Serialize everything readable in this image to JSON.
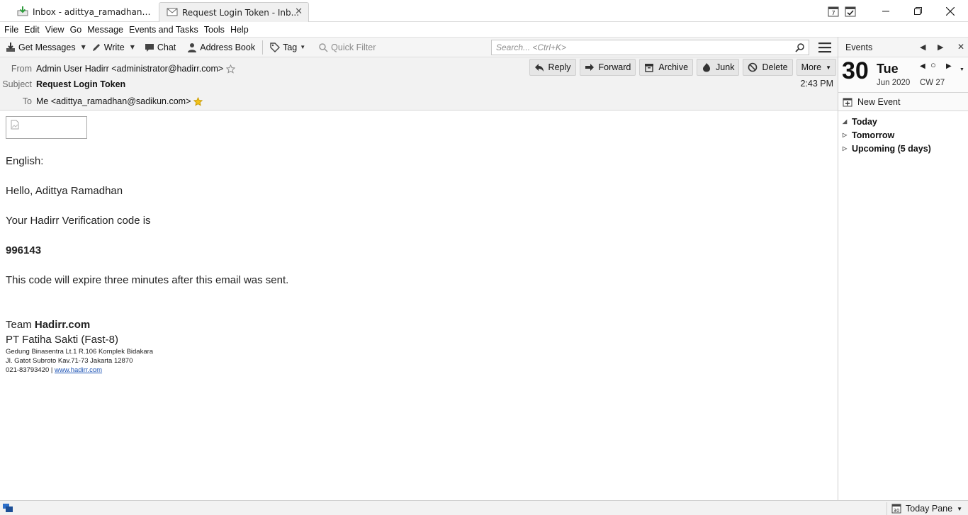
{
  "tabs": [
    {
      "label": "Inbox - adittya_ramadhan@sa...",
      "icon": "inbox-download-icon"
    },
    {
      "label": "Request Login Token - Inb...",
      "icon": "envelope-icon",
      "active": true
    }
  ],
  "menu": [
    "File",
    "Edit",
    "View",
    "Go",
    "Message",
    "Events and Tasks",
    "Tools",
    "Help"
  ],
  "toolbar": {
    "get_messages": "Get Messages",
    "write": "Write",
    "chat": "Chat",
    "address_book": "Address Book",
    "tag": "Tag",
    "quick_filter": "Quick Filter",
    "search_placeholder": "Search... <Ctrl+K>"
  },
  "header": {
    "from_label": "From",
    "from_value": "Admin User Hadirr <administrator@hadirr.com>",
    "subject_label": "Subject",
    "subject_value": "Request Login Token",
    "to_label": "To",
    "to_value": "Me <adittya_ramadhan@sadikun.com>",
    "time": "2:43 PM",
    "buttons": {
      "reply": "Reply",
      "forward": "Forward",
      "archive": "Archive",
      "junk": "Junk",
      "delete": "Delete",
      "more": "More"
    }
  },
  "message": {
    "lang": "English:",
    "greeting": "Hello, Adittya Ramadhan",
    "intro": "Your Hadirr Verification code is",
    "code": "996143",
    "expiry": "This code will expire three minutes after this email was sent.",
    "team_prefix": "Team",
    "team_name": "Hadirr.com",
    "company": "PT Fatiha Sakti (Fast-8)",
    "address1": "Gedung Binasentra Lt.1 R.106 Komplek Bidakara",
    "address2": "Jl. Gatot Subroto Kav.71-73 Jakarta 12870",
    "phone": "021-83793420 |",
    "website": "www.hadirr.com"
  },
  "today_pane": {
    "title": "Events",
    "day_num": "30",
    "day_name": "Tue",
    "month_year": "Jun 2020",
    "cw": "CW 27",
    "new_event": "New Event",
    "agenda": [
      "Today",
      "Tomorrow",
      "Upcoming (5 days)"
    ]
  },
  "status": {
    "today_pane_label": "Today Pane",
    "today_pane_day": "30"
  },
  "colors": {
    "accent_star": "#f2c21a",
    "link": "#1f55b5"
  }
}
